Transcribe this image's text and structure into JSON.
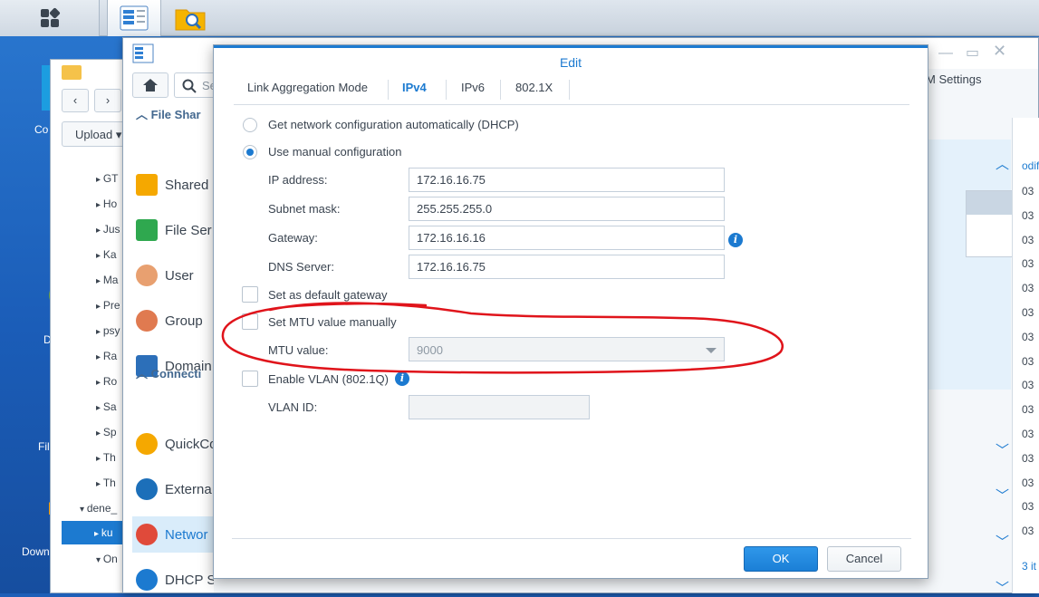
{
  "desktop": {
    "icons": [
      {
        "label": "Co"
      },
      {
        "label": "D"
      },
      {
        "label": "Fil"
      },
      {
        "label": "Down"
      }
    ]
  },
  "file_manager": {
    "upload_label": "Upload",
    "tree": [
      "GT",
      "Ho",
      "Jus",
      "Ka",
      "Ma",
      "Pre",
      "psy",
      "Ra",
      "Ro",
      "Sa",
      "Sp",
      "Th",
      "Th",
      "dene_",
      "ku",
      "On"
    ]
  },
  "control_panel": {
    "sidebar": {
      "search_placeholder": "Se",
      "section_file_sharing": "File Shar",
      "items_file": [
        {
          "label": "Shared"
        },
        {
          "label": "File Ser"
        },
        {
          "label": "User"
        },
        {
          "label": "Group"
        },
        {
          "label": "Domain"
        }
      ],
      "section_connectivity": "Connecti",
      "items_conn": [
        {
          "label": "QuickCo"
        },
        {
          "label": "Externa"
        },
        {
          "label": "Networ"
        },
        {
          "label": "DHCP S"
        }
      ]
    },
    "right_title": "DSM Settings"
  },
  "far_right": {
    "header": "odifi",
    "values": [
      "03",
      "03",
      "03",
      "03",
      "03",
      "03",
      "03",
      "03",
      "03",
      "03",
      "03",
      "03",
      "03",
      "03",
      "03"
    ],
    "footer": "3 it"
  },
  "dialog": {
    "title": "Edit",
    "tabs": [
      "Link Aggregation Mode",
      "IPv4",
      "IPv6",
      "802.1X"
    ],
    "active_tab": "IPv4",
    "dhcp_label": "Get network configuration automatically (DHCP)",
    "manual_label": "Use manual configuration",
    "selected_mode": "manual",
    "ip_label": "IP address:",
    "ip_value": "172.16.16.75",
    "subnet_label": "Subnet mask:",
    "subnet_value": "255.255.255.0",
    "gateway_label": "Gateway:",
    "gateway_value": "172.16.16.16",
    "dns_label": "DNS Server:",
    "dns_value": "172.16.16.75",
    "default_gw_label": "Set as default gateway",
    "mtu_manual_label": "Set MTU value manually",
    "mtu_label": "MTU value:",
    "mtu_value": "9000",
    "vlan_label": "Enable VLAN (802.1Q)",
    "vlan_id_label": "VLAN ID:",
    "vlan_id_value": "",
    "ok_label": "OK",
    "cancel_label": "Cancel"
  },
  "colors": {
    "accent": "#1c7ad0",
    "annotation": "#e0141b"
  }
}
